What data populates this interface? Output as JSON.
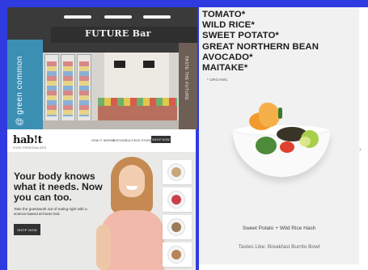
{
  "store": {
    "sign_text": "FUTURE Bar",
    "vertical_text": "@ green common",
    "pillar_text": "TASTE THE FUTURE"
  },
  "product": {
    "ingredients": [
      "TOMATO*",
      "WILD RICE*",
      "SWEET POTATO*",
      "GREAT NORTHERN BEAN",
      "AVOCADO*",
      "MAITAKE*"
    ],
    "organic_note": "* ORGANIC",
    "dish_name": "Sweet Potato + Wild Rice Hash",
    "tastes_like": "Tastes Like: Breakfast Burrito Bowl",
    "next_arrow": "›"
  },
  "habit": {
    "logo": "hab!t",
    "logo_sub": "FOOD PERSONALIZED",
    "nav": [
      "HOW IT WORKS",
      "SCIENCE",
      "SUCCESS STORIES"
    ],
    "nav_button": "SHOP NOW",
    "headline": "Your body knows what it needs. Now you can too.",
    "body": "Take the guesswork out of eating right with a science-based at-home test.",
    "cta": "SHOP NOW"
  }
}
